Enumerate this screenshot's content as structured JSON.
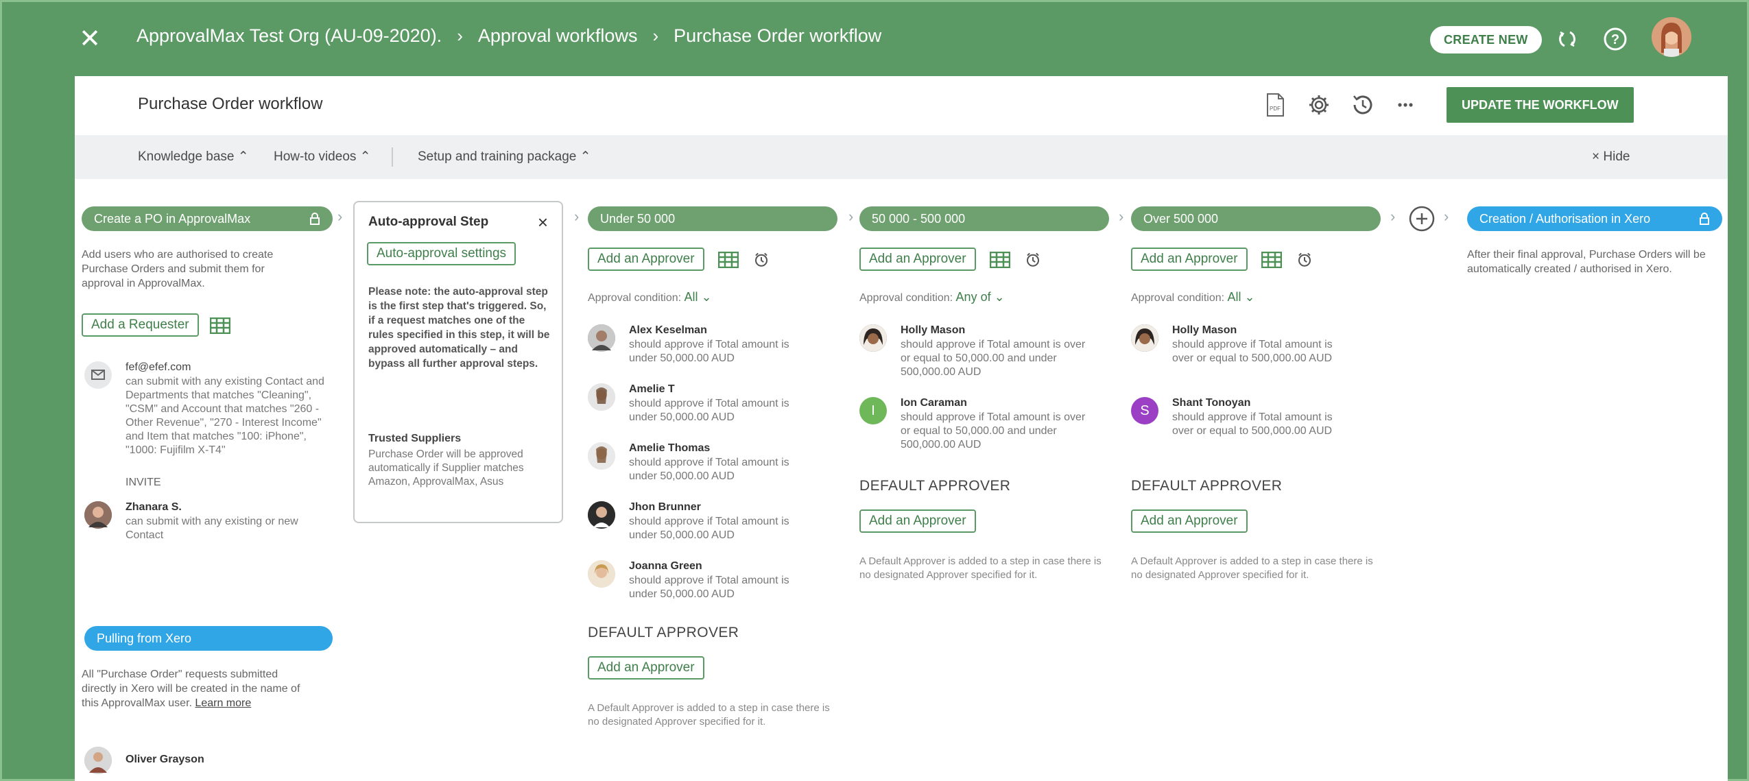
{
  "topbar": {
    "org": "ApprovalMax Test Org (AU-09-2020).",
    "crumb2": "Approval workflows",
    "crumb3": "Purchase Order workflow",
    "create_new": "CREATE NEW"
  },
  "titlebar": {
    "title": "Purchase Order workflow",
    "update": "UPDATE THE WORKFLOW"
  },
  "kb": {
    "knowledge": "Knowledge base ⌃",
    "videos": "How-to videos ⌃",
    "setup": "Setup and training package ⌃",
    "hide": "× Hide"
  },
  "col1": {
    "pill": "Create a PO in ApprovalMax",
    "desc": "Add users who are authorised to create Purchase Orders and submit them for approval in ApprovalMax.",
    "add_requester": "Add a Requester",
    "email": "fef@efef.com",
    "email_desc": "can submit with any existing Contact and Departments that matches \"Cleaning\", \"CSM\" and Account that matches \"260 - Other Revenue\", \"270 - Interest Income\" and Item that matches \"100: iPhone\", \"1000: Fujifilm X-T4\"",
    "invite": "INVITE",
    "user2": "Zhanara S.",
    "user2_desc": "can submit with any existing or new Contact",
    "pulling": "Pulling from Xero",
    "pulling_desc": "All \"Purchase Order\" requests submitted directly in Xero will be created in the name of this ApprovalMax user.",
    "learn_more": "Learn more",
    "user3": "Oliver Grayson"
  },
  "card": {
    "title": "Auto-approval Step",
    "settings": "Auto-approval settings",
    "note": "Please note: the auto-approval step is the first step that's triggered. So, if a request matches one of the rules specified in this step, it will be approved automatically – and bypass all further approval steps.",
    "ts_title": "Trusted Suppliers",
    "ts_desc": "Purchase Order will be approved automatically if Supplier matches Amazon, ApprovalMax, Asus"
  },
  "col2": {
    "pill": "Under 50 000",
    "add": "Add an Approver",
    "cond_label": "Approval condition:",
    "cond_value": "All ⌄",
    "approvers": [
      {
        "name": "Alex Keselman",
        "desc": "should approve if Total amount is under 50,000.00 AUD"
      },
      {
        "name": "Amelie T",
        "desc": "should approve if Total amount is under 50,000.00 AUD"
      },
      {
        "name": "Amelie Thomas",
        "desc": "should approve if Total amount is under 50,000.00 AUD"
      },
      {
        "name": "Jhon Brunner",
        "desc": "should approve if Total amount is under 50,000.00 AUD"
      },
      {
        "name": "Joanna Green",
        "desc": "should approve if Total amount is under 50,000.00 AUD"
      }
    ],
    "default_title": "DEFAULT APPROVER",
    "default_add": "Add an Approver",
    "default_desc": "A Default Approver is added to a step in case there is no designated Approver specified for it."
  },
  "col3": {
    "pill": "50 000 - 500 000",
    "add": "Add an Approver",
    "cond_label": "Approval condition:",
    "cond_value": "Any of ⌄",
    "approvers": [
      {
        "name": "Holly Mason",
        "desc": "should approve if Total amount is over or equal to 50,000.00 and under 500,000.00 AUD"
      },
      {
        "name": "Ion Caraman",
        "initial": "I",
        "desc": "should approve if Total amount is over or equal to 50,000.00 and under 500,000.00 AUD"
      }
    ],
    "default_title": "DEFAULT APPROVER",
    "default_add": "Add an Approver",
    "default_desc": "A Default Approver is added to a step in case there is no designated Approver specified for it."
  },
  "col4": {
    "pill": "Over 500 000",
    "add": "Add an Approver",
    "cond_label": "Approval condition:",
    "cond_value": "All ⌄",
    "approvers": [
      {
        "name": "Holly Mason",
        "desc": "should approve if Total amount is over or equal to 500,000.00 AUD"
      },
      {
        "name": "Shant Tonoyan",
        "initial": "S",
        "desc": "should approve if Total amount is over or equal to 500,000.00 AUD"
      }
    ],
    "default_title": "DEFAULT APPROVER",
    "default_add": "Add an Approver",
    "default_desc": "A Default Approver is added to a step in case there is no designated Approver specified for it."
  },
  "col5": {
    "pill": "Creation / Authorisation in Xero",
    "desc": "After their final approval, Purchase Orders will be automatically created / authorised in Xero."
  },
  "colors": {
    "header_green": "#5b9a65",
    "pill_green": "#6ea16f",
    "pill_blue": "#30a6e6",
    "ion_avatar": "#6fb85a",
    "shant_avatar": "#9b3fc4"
  }
}
